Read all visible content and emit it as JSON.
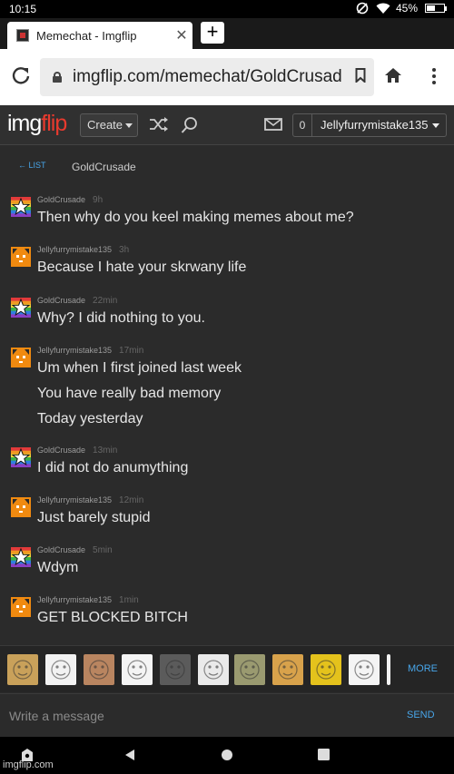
{
  "status": {
    "time": "10:15",
    "battery": "45%"
  },
  "browser": {
    "tab_title": "Memechat - Imgflip",
    "url": "imgflip.com/memechat/GoldCrusad"
  },
  "site": {
    "logo_a": "img",
    "logo_b": "flip",
    "create_label": "Create",
    "notif_count": "0",
    "username": "Jellyfurrymistake135"
  },
  "chat": {
    "back_label": "← LIST",
    "partner": "GoldCrusade",
    "messages": [
      {
        "user": "GoldCrusade",
        "ago": "9h",
        "avatar": "star-avatar",
        "lines": [
          "Then why do you keel making memes about me?"
        ]
      },
      {
        "user": "Jellyfurrymistake135",
        "ago": "3h",
        "avatar": "cat-avatar",
        "lines": [
          "Because I hate your skrwany life"
        ]
      },
      {
        "user": "GoldCrusade",
        "ago": "22min",
        "avatar": "star-avatar",
        "lines": [
          "Why? I did nothing to you."
        ]
      },
      {
        "user": "Jellyfurrymistake135",
        "ago": "17min",
        "avatar": "cat-avatar",
        "lines": [
          "Um when I first joined last week",
          "You have really bad memory",
          "Today yesterday"
        ]
      },
      {
        "user": "GoldCrusade",
        "ago": "13min",
        "avatar": "star-avatar",
        "lines": [
          "I did not do anumything"
        ]
      },
      {
        "user": "Jellyfurrymistake135",
        "ago": "12min",
        "avatar": "cat-avatar",
        "lines": [
          "Just barely stupid"
        ]
      },
      {
        "user": "GoldCrusade",
        "ago": "5min",
        "avatar": "star-avatar",
        "lines": [
          "Wdym"
        ]
      },
      {
        "user": "Jellyfurrymistake135",
        "ago": "1min",
        "avatar": "cat-avatar",
        "lines": [
          "GET BLOCKED BITCH"
        ]
      }
    ]
  },
  "templates": {
    "items": [
      {
        "name": "cat-meme-thumb",
        "color": "#c9a15a"
      },
      {
        "name": "rage-face-thumb",
        "color": "#f2f2f2"
      },
      {
        "name": "jesus-thumb",
        "color": "#b98560"
      },
      {
        "name": "troll-face-thumb",
        "color": "#f4f4f4"
      },
      {
        "name": "skull-thumb",
        "color": "#5b5b5b"
      },
      {
        "name": "crying-face-thumb",
        "color": "#eaeaea"
      },
      {
        "name": "glasses-cat-thumb",
        "color": "#9a9a70"
      },
      {
        "name": "doge-thumb",
        "color": "#d8a24b"
      },
      {
        "name": "spongebob-thumb",
        "color": "#e4c21c"
      },
      {
        "name": "meme-face-thumb",
        "color": "#f4f4f4"
      }
    ],
    "more_label": "MORE"
  },
  "composer": {
    "placeholder": "Write a message",
    "send_label": "SEND"
  },
  "watermark": "imgflip.com",
  "colors": {
    "accent": "#48a6ea",
    "logo_red": "#e83a2e",
    "cat_orange": "#f08a10"
  }
}
